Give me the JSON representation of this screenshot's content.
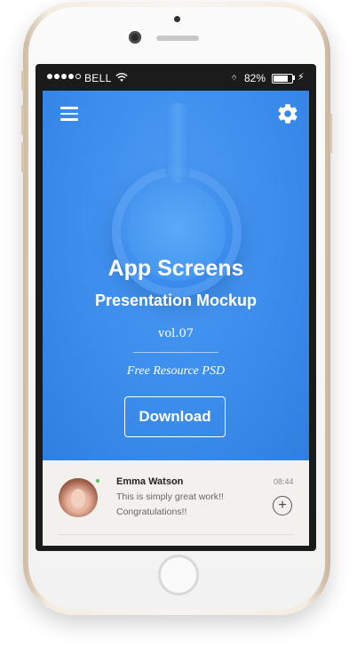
{
  "status_bar": {
    "carrier": "BELL",
    "battery_percent": "82%",
    "signal_bars_filled": 4,
    "signal_bars_total": 5,
    "battery_level": 0.82
  },
  "hero": {
    "title": "App Screens",
    "subtitle": "Presentation Mockup",
    "volume": "vol.07",
    "tagline": "Free Resource PSD",
    "download_label": "Download",
    "background_color": "#3e8fee"
  },
  "message": {
    "name": "Emma Watson",
    "line1": "This is simply great work!!",
    "line2": "Congratulations!!",
    "time": "08:44",
    "add_icon": "+"
  },
  "icons": {
    "menu": "hamburger-icon",
    "settings": "gear-icon",
    "add": "plus-circle-icon"
  }
}
